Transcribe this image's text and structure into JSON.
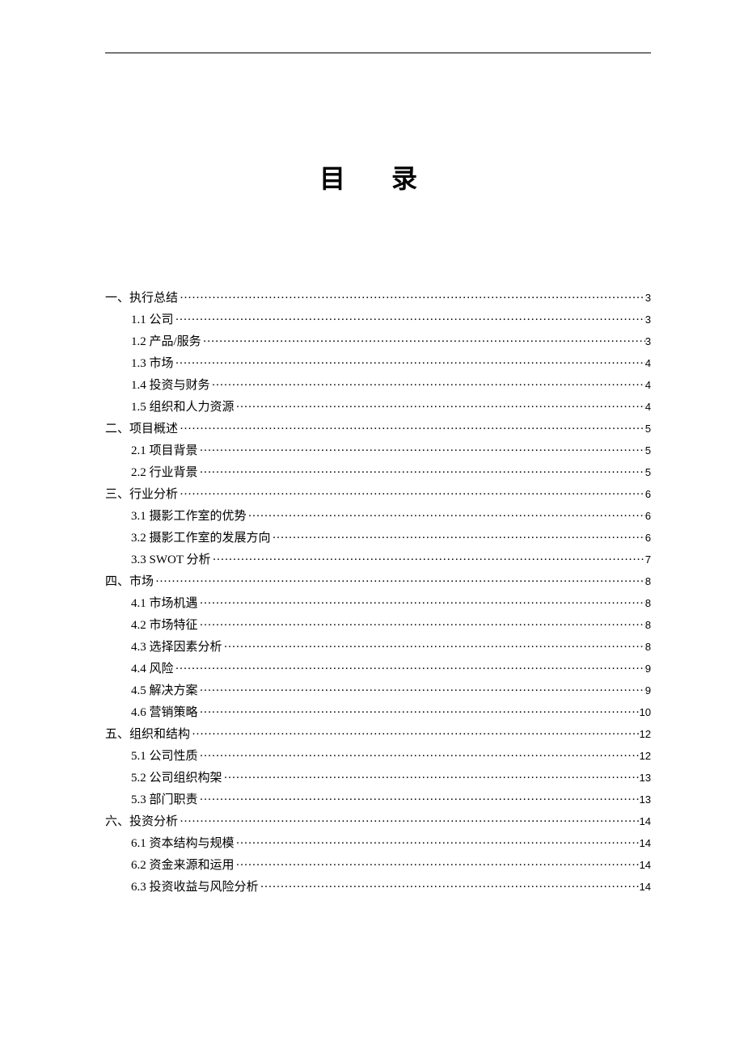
{
  "title": "目 录",
  "toc": [
    {
      "level": 1,
      "label": "一、执行总结",
      "page": "3"
    },
    {
      "level": 2,
      "label": "1.1 公司",
      "page": "3"
    },
    {
      "level": 2,
      "label": "1.2 产品/服务",
      "page": "3"
    },
    {
      "level": 2,
      "label": "1.3 市场",
      "page": "4"
    },
    {
      "level": 2,
      "label": "1.4 投资与财务",
      "page": "4"
    },
    {
      "level": 2,
      "label": "1.5 组织和人力资源",
      "page": "4"
    },
    {
      "level": 1,
      "label": "二、项目概述",
      "page": "5"
    },
    {
      "level": 2,
      "label": "2.1 项目背景",
      "page": "5"
    },
    {
      "level": 2,
      "label": "2.2 行业背景",
      "page": "5"
    },
    {
      "level": 1,
      "label": "三、行业分析",
      "page": "6"
    },
    {
      "level": 2,
      "label": "3.1 摄影工作室的优势",
      "page": "6"
    },
    {
      "level": 2,
      "label": "3.2 摄影工作室的发展方向",
      "page": "6"
    },
    {
      "level": 2,
      "label": "3.3 SWOT 分析",
      "page": "7"
    },
    {
      "level": 1,
      "label": "四、市场",
      "page": "8"
    },
    {
      "level": 2,
      "label": "4.1 市场机遇",
      "page": "8"
    },
    {
      "level": 2,
      "label": "4.2 市场特征",
      "page": "8"
    },
    {
      "level": 2,
      "label": "4.3 选择因素分析",
      "page": "8"
    },
    {
      "level": 2,
      "label": "4.4 风险",
      "page": "9"
    },
    {
      "level": 2,
      "label": "4.5 解决方案",
      "page": "9"
    },
    {
      "level": 2,
      "label": "4.6 营销策略",
      "page": "10"
    },
    {
      "level": 1,
      "label": "五、组织和结构",
      "page": "12"
    },
    {
      "level": 2,
      "label": "5.1 公司性质",
      "page": "12"
    },
    {
      "level": 2,
      "label": "5.2 公司组织构架",
      "page": "13"
    },
    {
      "level": 2,
      "label": "5.3 部门职责",
      "page": "13"
    },
    {
      "level": 1,
      "label": "六、投资分析",
      "page": "14"
    },
    {
      "level": 2,
      "label": "6.1 资本结构与规模",
      "page": "14"
    },
    {
      "level": 2,
      "label": "6.2 资金来源和运用",
      "page": "14"
    },
    {
      "level": 2,
      "label": "6.3 投资收益与风险分析",
      "page": "14"
    }
  ]
}
